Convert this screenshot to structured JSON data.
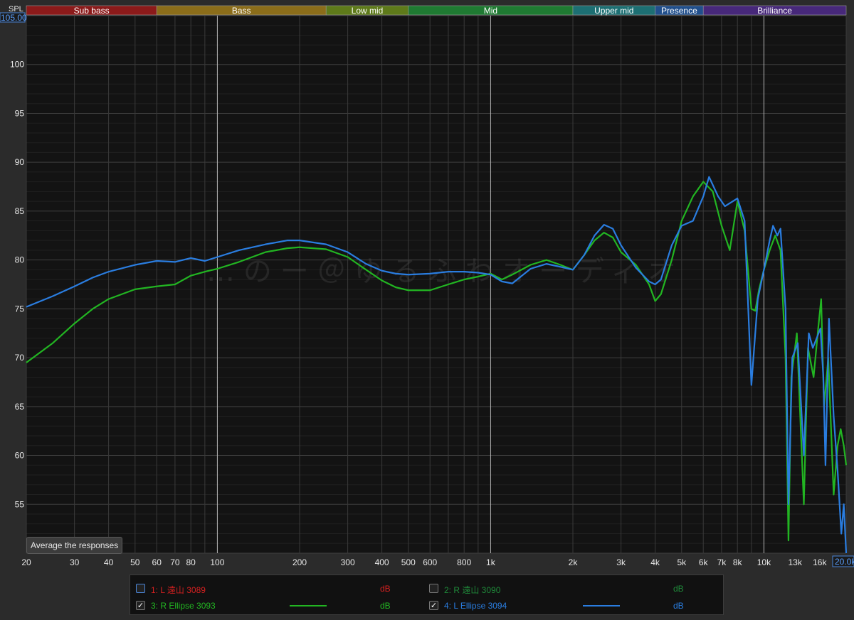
{
  "watermark": "…のー＠ゆるふわオーディオ",
  "buttons": {
    "average": "Average the responses"
  },
  "axis": {
    "ylabel": "SPL",
    "ytop_value": "105.00",
    "xright_value": "20.0k"
  },
  "bands": [
    {
      "label": "Sub bass",
      "color": "#8b1a1a",
      "from": 20,
      "to": 60
    },
    {
      "label": "Bass",
      "color": "#8b6d1a",
      "from": 60,
      "to": 250
    },
    {
      "label": "Low mid",
      "color": "#5e7a1a",
      "from": 250,
      "to": 500
    },
    {
      "label": "Mid",
      "color": "#1f7a32",
      "from": 500,
      "to": 2000
    },
    {
      "label": "Upper mid",
      "color": "#1d6f73",
      "from": 2000,
      "to": 4000
    },
    {
      "label": "Presence",
      "color": "#214f8c",
      "from": 4000,
      "to": 6000
    },
    {
      "label": "Brilliance",
      "color": "#47287a",
      "from": 6000,
      "to": 20000
    }
  ],
  "legend": [
    {
      "id": "1",
      "text": "1: L 遠山 3089",
      "checked": false,
      "color": "#d42020",
      "unit": "dB",
      "show_swatch": false
    },
    {
      "id": "2",
      "text": "2: R 遠山 3090",
      "checked": false,
      "color": "#1f8a3a",
      "unit": "dB",
      "show_swatch": false
    },
    {
      "id": "3",
      "text": "3: R Ellipse 3093",
      "checked": true,
      "color": "#22b522",
      "unit": "dB",
      "show_swatch": true
    },
    {
      "id": "4",
      "text": "4: L Ellipse 3094",
      "checked": true,
      "color": "#2a7de0",
      "unit": "dB",
      "show_swatch": true
    }
  ],
  "chart_data": {
    "type": "line",
    "ylabel": "SPL",
    "xscale": "log",
    "xlim": [
      20,
      20000
    ],
    "ylim": [
      50,
      105
    ],
    "xticks": [
      {
        "v": 20,
        "label": "20"
      },
      {
        "v": 30,
        "label": "30"
      },
      {
        "v": 40,
        "label": "40"
      },
      {
        "v": 50,
        "label": "50"
      },
      {
        "v": 60,
        "label": "60"
      },
      {
        "v": 70,
        "label": "70"
      },
      {
        "v": 80,
        "label": "80"
      },
      {
        "v": 100,
        "label": "100"
      },
      {
        "v": 200,
        "label": "200"
      },
      {
        "v": 300,
        "label": "300"
      },
      {
        "v": 400,
        "label": "400"
      },
      {
        "v": 500,
        "label": "500"
      },
      {
        "v": 600,
        "label": "600"
      },
      {
        "v": 800,
        "label": "800"
      },
      {
        "v": 1000,
        "label": "1k"
      },
      {
        "v": 2000,
        "label": "2k"
      },
      {
        "v": 3000,
        "label": "3k"
      },
      {
        "v": 4000,
        "label": "4k"
      },
      {
        "v": 5000,
        "label": "5k"
      },
      {
        "v": 6000,
        "label": "6k"
      },
      {
        "v": 7000,
        "label": "7k"
      },
      {
        "v": 8000,
        "label": "8k"
      },
      {
        "v": 10000,
        "label": "10k"
      },
      {
        "v": 13000,
        "label": "13k"
      },
      {
        "v": 16000,
        "label": "16k"
      }
    ],
    "yticks": [
      55,
      60,
      65,
      70,
      75,
      80,
      85,
      90,
      95,
      100
    ],
    "grid": true,
    "legend_position": "bottom",
    "series": [
      {
        "name": "3: R Ellipse 3093",
        "color": "#22b522",
        "points": [
          [
            20,
            69.5
          ],
          [
            25,
            71.5
          ],
          [
            30,
            73.5
          ],
          [
            35,
            75
          ],
          [
            40,
            76
          ],
          [
            50,
            77
          ],
          [
            60,
            77.3
          ],
          [
            70,
            77.5
          ],
          [
            80,
            78.4
          ],
          [
            90,
            78.8
          ],
          [
            100,
            79.1
          ],
          [
            120,
            79.8
          ],
          [
            150,
            80.8
          ],
          [
            180,
            81.2
          ],
          [
            200,
            81.3
          ],
          [
            250,
            81.1
          ],
          [
            300,
            80.3
          ],
          [
            350,
            79
          ],
          [
            400,
            77.9
          ],
          [
            450,
            77.2
          ],
          [
            500,
            76.9
          ],
          [
            600,
            76.9
          ],
          [
            700,
            77.5
          ],
          [
            800,
            78
          ],
          [
            900,
            78.3
          ],
          [
            1000,
            78.6
          ],
          [
            1100,
            78
          ],
          [
            1200,
            78.5
          ],
          [
            1400,
            79.5
          ],
          [
            1600,
            80
          ],
          [
            1800,
            79.5
          ],
          [
            2000,
            79
          ],
          [
            2200,
            80.5
          ],
          [
            2400,
            82
          ],
          [
            2600,
            82.8
          ],
          [
            2800,
            82.3
          ],
          [
            3000,
            80.8
          ],
          [
            3400,
            79.5
          ],
          [
            3800,
            77.5
          ],
          [
            4000,
            75.8
          ],
          [
            4200,
            76.5
          ],
          [
            4600,
            80
          ],
          [
            5000,
            84
          ],
          [
            5500,
            86.5
          ],
          [
            6000,
            88
          ],
          [
            6500,
            87
          ],
          [
            7000,
            83.5
          ],
          [
            7500,
            81
          ],
          [
            8000,
            86
          ],
          [
            8500,
            83
          ],
          [
            9000,
            75
          ],
          [
            9300,
            74.8
          ],
          [
            9600,
            77
          ],
          [
            10000,
            79
          ],
          [
            10500,
            81
          ],
          [
            11000,
            82.5
          ],
          [
            11500,
            81
          ],
          [
            12000,
            70
          ],
          [
            12300,
            51.3
          ],
          [
            12600,
            68
          ],
          [
            13200,
            72.5
          ],
          [
            14000,
            55
          ],
          [
            14500,
            71
          ],
          [
            15200,
            68
          ],
          [
            15800,
            73
          ],
          [
            16200,
            76
          ],
          [
            16600,
            65
          ],
          [
            17200,
            70
          ],
          [
            18000,
            56
          ],
          [
            18600,
            61
          ],
          [
            19100,
            62.7
          ],
          [
            19600,
            61
          ],
          [
            20000,
            59
          ]
        ]
      },
      {
        "name": "4: L Ellipse 3094",
        "color": "#2a7de0",
        "points": [
          [
            20,
            75.2
          ],
          [
            25,
            76.3
          ],
          [
            30,
            77.3
          ],
          [
            35,
            78.2
          ],
          [
            40,
            78.8
          ],
          [
            50,
            79.5
          ],
          [
            60,
            79.9
          ],
          [
            70,
            79.8
          ],
          [
            80,
            80.2
          ],
          [
            90,
            79.9
          ],
          [
            100,
            80.3
          ],
          [
            120,
            81
          ],
          [
            150,
            81.6
          ],
          [
            180,
            82
          ],
          [
            200,
            82
          ],
          [
            250,
            81.6
          ],
          [
            300,
            80.8
          ],
          [
            350,
            79.6
          ],
          [
            400,
            78.9
          ],
          [
            450,
            78.6
          ],
          [
            500,
            78.5
          ],
          [
            600,
            78.6
          ],
          [
            700,
            78.8
          ],
          [
            800,
            78.8
          ],
          [
            900,
            78.7
          ],
          [
            1000,
            78.5
          ],
          [
            1100,
            77.8
          ],
          [
            1200,
            77.6
          ],
          [
            1400,
            79.1
          ],
          [
            1600,
            79.6
          ],
          [
            1800,
            79.3
          ],
          [
            2000,
            79
          ],
          [
            2200,
            80.5
          ],
          [
            2400,
            82.5
          ],
          [
            2600,
            83.6
          ],
          [
            2800,
            83.2
          ],
          [
            3000,
            81.5
          ],
          [
            3400,
            79.2
          ],
          [
            3800,
            77.8
          ],
          [
            4000,
            77.5
          ],
          [
            4200,
            78
          ],
          [
            4600,
            81.5
          ],
          [
            5000,
            83.5
          ],
          [
            5500,
            84
          ],
          [
            6000,
            86.5
          ],
          [
            6300,
            88.5
          ],
          [
            6800,
            86.5
          ],
          [
            7200,
            85.5
          ],
          [
            8000,
            86.3
          ],
          [
            8500,
            84
          ],
          [
            9000,
            67.2
          ],
          [
            9500,
            76
          ],
          [
            10000,
            79
          ],
          [
            10500,
            82
          ],
          [
            10800,
            83.5
          ],
          [
            11200,
            82.5
          ],
          [
            11500,
            83.2
          ],
          [
            12000,
            75
          ],
          [
            12300,
            55
          ],
          [
            12700,
            70
          ],
          [
            13300,
            71.5
          ],
          [
            14000,
            60
          ],
          [
            14600,
            72.5
          ],
          [
            15100,
            71
          ],
          [
            15600,
            72
          ],
          [
            16100,
            73
          ],
          [
            16500,
            68
          ],
          [
            16800,
            59
          ],
          [
            17300,
            74
          ],
          [
            18000,
            64
          ],
          [
            18600,
            58.5
          ],
          [
            19200,
            52
          ],
          [
            19600,
            55
          ],
          [
            20000,
            50
          ]
        ]
      }
    ]
  }
}
